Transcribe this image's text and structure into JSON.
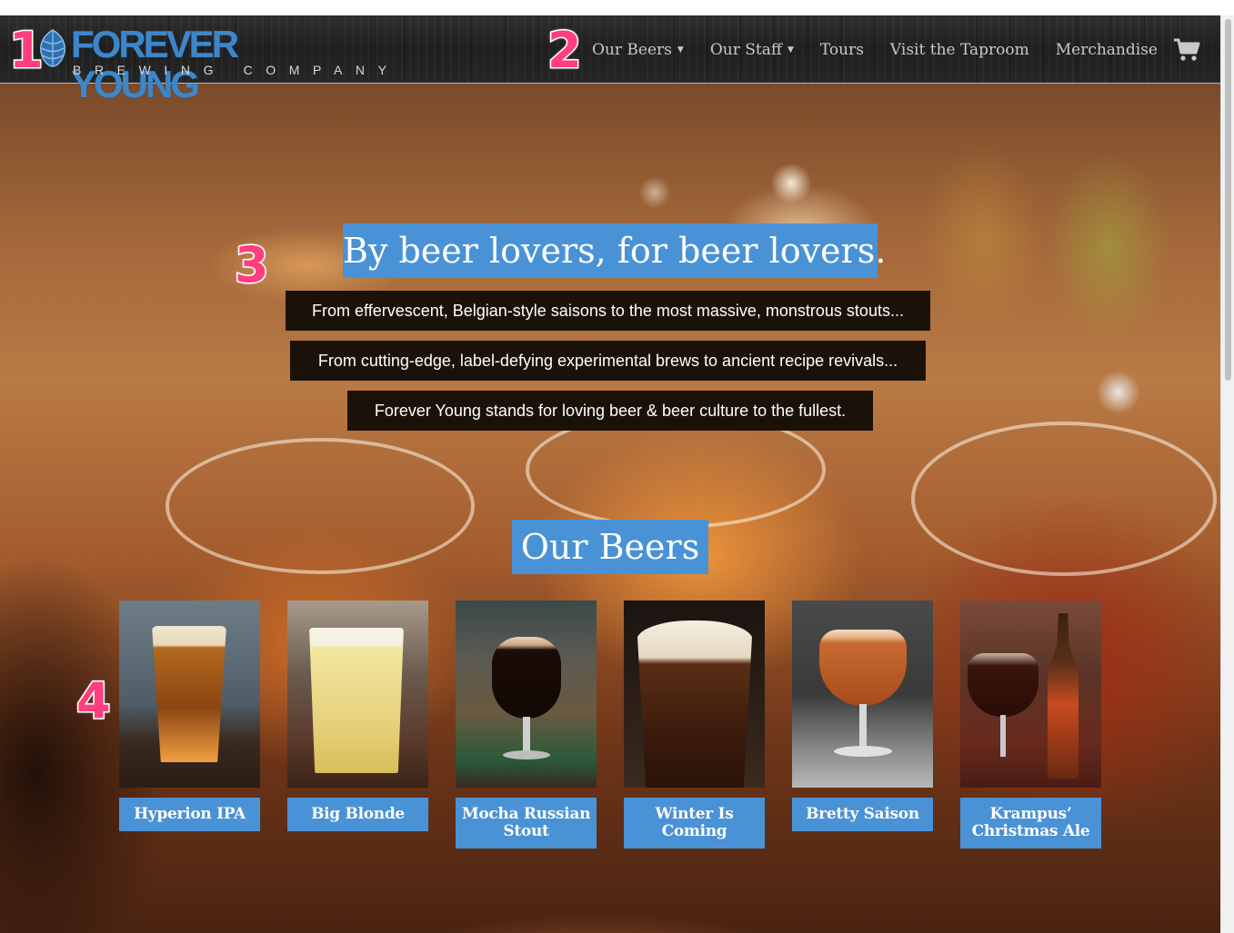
{
  "brand": {
    "name": "FOREVER YOUNG",
    "subtitle": "BREWING COMPANY",
    "accent": "#4a92d6"
  },
  "nav": {
    "items": [
      {
        "label": "Our Beers",
        "dropdown": true
      },
      {
        "label": "Our Staff",
        "dropdown": true
      },
      {
        "label": "Tours",
        "dropdown": false
      },
      {
        "label": "Visit the Taproom",
        "dropdown": false
      },
      {
        "label": "Merchandise",
        "dropdown": false
      }
    ],
    "cart_icon": "shopping-cart-icon"
  },
  "hero": {
    "tagline": "By beer lovers, for beer lovers.",
    "blurbs": [
      "From effervescent, Belgian-style saisons to the most massive, monstrous stouts...",
      "From cutting-edge, label-defying experimental brews to ancient recipe revivals...",
      "Forever Young stands for loving beer & beer culture to the fullest."
    ]
  },
  "beers": {
    "heading": "Our Beers",
    "items": [
      {
        "name": "Hyperion IPA"
      },
      {
        "name": "Big Blonde"
      },
      {
        "name": "Mocha Russian Stout"
      },
      {
        "name": "Winter Is Coming"
      },
      {
        "name": "Bretty Saison"
      },
      {
        "name": "Krampus’ Christmas Ale"
      }
    ]
  },
  "annotations": [
    "1",
    "2",
    "3",
    "4"
  ],
  "colors": {
    "accent_blue": "#4a92d6",
    "annotation_pink": "#ff3d7f",
    "navbar_dark": "#262626",
    "blurb_bg": "#1a1208"
  }
}
